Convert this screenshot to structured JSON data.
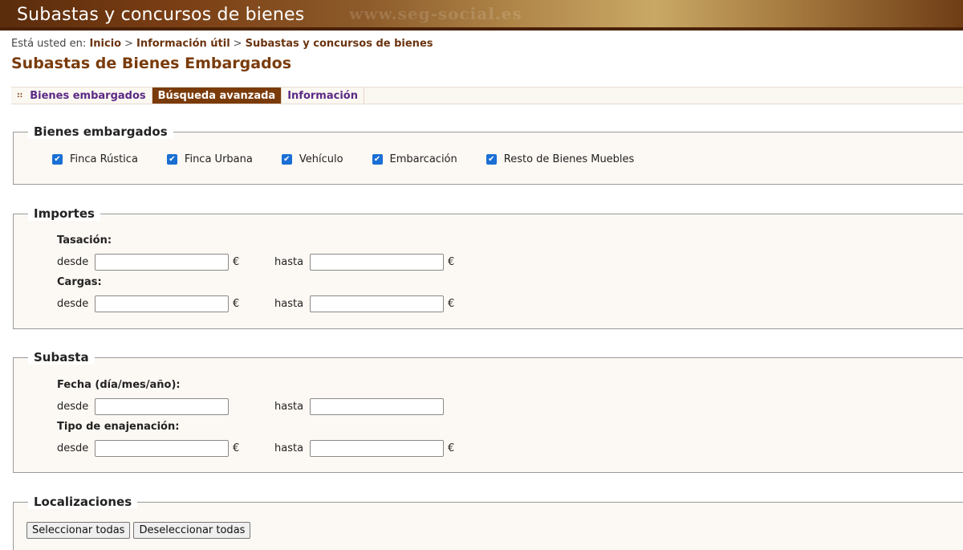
{
  "banner": {
    "title": "Subastas y concursos de bienes",
    "watermark": "www.seg-social.es"
  },
  "breadcrumb": {
    "prefix": "Está usted en:",
    "items": [
      "Inicio",
      "Información útil",
      "Subastas y concursos de bienes"
    ],
    "separator": ">"
  },
  "page_title": "Subastas de Bienes Embargados",
  "tabs": [
    {
      "label": "Bienes embargados",
      "active": false,
      "bullet": "::"
    },
    {
      "label": "Búsqueda avanzada",
      "active": true
    },
    {
      "label": "Información",
      "active": false
    }
  ],
  "bienes": {
    "legend": "Bienes embargados",
    "options": [
      {
        "label": "Finca Rústica",
        "checked": true
      },
      {
        "label": "Finca Urbana",
        "checked": true
      },
      {
        "label": "Vehículo",
        "checked": true
      },
      {
        "label": "Embarcación",
        "checked": true
      },
      {
        "label": "Resto de Bienes Muebles",
        "checked": true
      }
    ]
  },
  "importes": {
    "legend": "Importes",
    "tasacion_label": "Tasación:",
    "cargas_label": "Cargas:",
    "desde": "desde",
    "hasta": "hasta",
    "currency": "€",
    "tasacion_desde": "",
    "tasacion_hasta": "",
    "cargas_desde": "",
    "cargas_hasta": ""
  },
  "subasta": {
    "legend": "Subasta",
    "fecha_label": "Fecha (día/mes/año):",
    "tipo_label": "Tipo de enajenación:",
    "desde": "desde",
    "hasta": "hasta",
    "currency": "€",
    "fecha_desde": "",
    "fecha_hasta": "",
    "tipo_desde": "",
    "tipo_hasta": ""
  },
  "localizaciones": {
    "legend": "Localizaciones",
    "select_all": "Seleccionar todas",
    "deselect_all": "Deseleccionar todas"
  },
  "colors": {
    "accent": "#7a3b0b",
    "tab_text": "#5b2a86",
    "checkbox": "#1a6fd4",
    "section_bg": "#fcf8f3"
  }
}
